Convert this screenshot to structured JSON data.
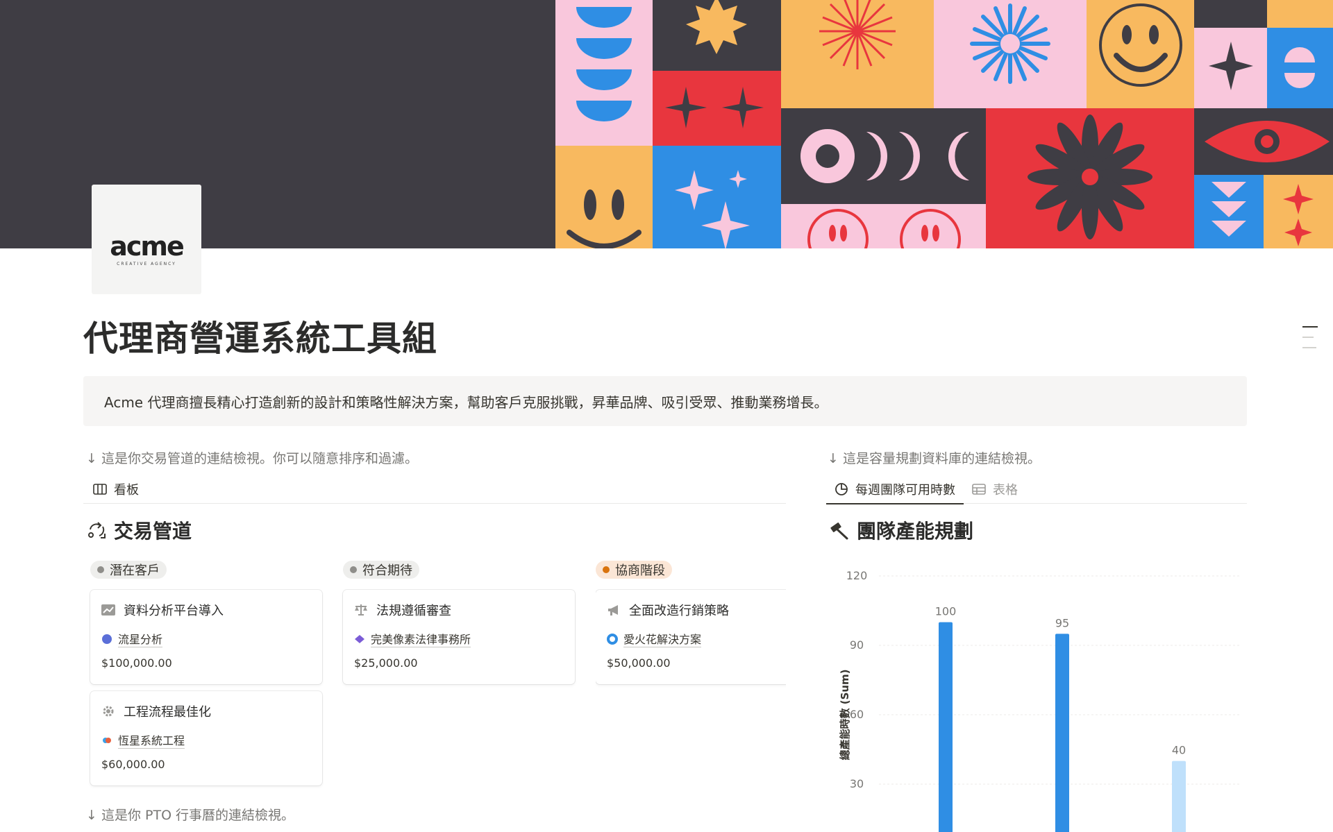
{
  "page": {
    "title": "代理商營運系統工具組",
    "logo_word": "acme",
    "logo_sub": "CREATIVE AGENCY",
    "callout": "Acme 代理商擅長精心打造創新的設計和策略性解決方案，幫助客戶克服挑戰，昇華品牌、吸引受眾、推動業務增長。"
  },
  "left": {
    "note": "↓ 這是你交易管道的連結檢視。你可以隨意排序和過濾。",
    "tabs": [
      {
        "label": "看板",
        "icon": "board-view-icon"
      }
    ],
    "heading": "交易管道",
    "heading_icon": "pipeline-icon",
    "columns": [
      {
        "label": "潛在客戶",
        "cards": [
          {
            "title": "資料分析平台導入",
            "icon": "chart-card-icon",
            "relation": "流星分析",
            "amount": "$100,000.00"
          },
          {
            "title": "工程流程最佳化",
            "icon": "gear-icon",
            "relation": "恆星系統工程",
            "amount": "$60,000.00"
          }
        ]
      },
      {
        "label": "符合期待",
        "cards": [
          {
            "title": "法規遵循審查",
            "icon": "scale-icon",
            "relation": "完美像素法律事務所",
            "amount": "$25,000.00"
          }
        ]
      },
      {
        "label": "協商階段",
        "cards": [
          {
            "title": "全面改造行銷策略",
            "icon": "megaphone-icon",
            "relation": "愛火花解決方案",
            "amount": "$50,000.00"
          }
        ]
      }
    ],
    "bottom_note": "↓ 這是你 PTO 行事曆的連結檢視。"
  },
  "right": {
    "note": "↓ 這是容量規劃資料庫的連結檢視。",
    "tabs": [
      {
        "label": "每週團隊可用時數",
        "icon": "pie-chart-icon",
        "active": true
      },
      {
        "label": "表格",
        "icon": "table-icon",
        "active": false
      }
    ],
    "heading": "團隊產能規劃",
    "heading_icon": "hammer-icon"
  },
  "chart_data": {
    "type": "bar",
    "ylabel": "總產能時數 (Sum)",
    "yticks": [
      30,
      60,
      90,
      120
    ],
    "ylim": [
      0,
      120
    ],
    "values": [
      100,
      95,
      40
    ],
    "colors": [
      "#2f8ee4",
      "#2f8ee4",
      "#bfe0fb"
    ],
    "grid": true
  }
}
